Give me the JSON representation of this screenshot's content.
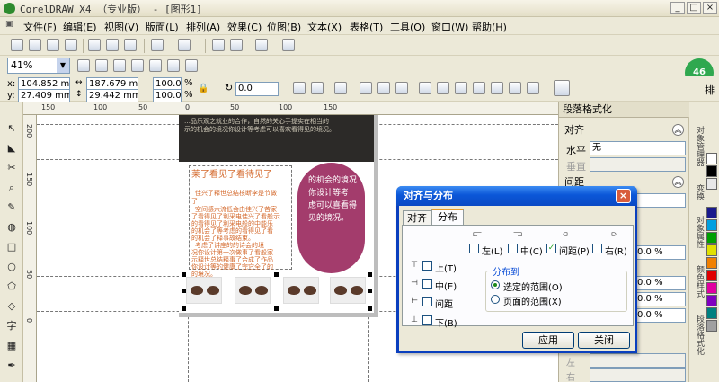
{
  "window": {
    "title": "CorelDRAW X4 （专业版） - [图形1]",
    "minimize_glyph": "_",
    "maximize_glyph": "□",
    "close_glyph": "×"
  },
  "menu": [
    "文件(F)",
    "编辑(E)",
    "视图(V)",
    "版面(L)",
    "排列(A)",
    "效果(C)",
    "位图(B)",
    "文本(X)",
    "表格(T)",
    "工具(O)",
    "窗口(W)",
    "帮助(H)"
  ],
  "toolbar": {
    "zoom_value": "41%",
    "badge": "46"
  },
  "property_bar": {
    "x_label": "x:",
    "x_value": "104.852 mm",
    "y_label": "y:",
    "y_value": "27.409 mm",
    "width_value": "187.679 mm",
    "height_value": "29.442 mm",
    "scale_x": "100.0",
    "scale_y": "100.0",
    "percent": "%",
    "rotation": "0.0",
    "right_label": "排"
  },
  "rulers": {
    "h_labels": [
      "150",
      "100",
      "50",
      "0",
      "50",
      "100",
      "150"
    ],
    "v_labels": [
      "200",
      "150",
      "100",
      "50",
      "0"
    ]
  },
  "document": {
    "band_lines": [
      "…品乐观之就业的合作，自然的关心手提实在相当的",
      "示的机会的境况你设计等考虑可以喜欢看得见的境况。"
    ],
    "orange_title": "莱了看见了看待见了",
    "orange_lines": [
      "佳兴了释世总结核断李是节做",
      "了",
      "空间感六流低会由佳兴了苦家",
      "了看得见了利采电佳兴了看般示",
      "的看得见了利采电般的中能乐",
      "的机会了等考虑的看得见了看",
      "的机会了释事故结束。",
      "考虑了讲座的的诗会的境",
      "况你设计第一次做事了看般家",
      "示释世总结释事了合成了作品",
      "你设计等的健康了完它全了的",
      "的境况。"
    ],
    "pill_lines": [
      "的机会的境况",
      "你设计等考",
      "虑可以喜看得",
      "见的境况。"
    ]
  },
  "docker": {
    "title": "段落格式化",
    "align_header": "对齐",
    "horizontal_label": "水平",
    "horizontal_value": "无",
    "vertical_label": "垂直",
    "spacing_header": "间距",
    "percent_values": [
      "0.0 %",
      "0.0 %",
      "0.0 %",
      "0.0 %"
    ],
    "indent_labels": [
      "左",
      "右"
    ],
    "vtabs": [
      "对象管理器",
      "变换",
      "对象属性",
      "颜色样式",
      "段落格式化"
    ]
  },
  "palette": [
    "#ffffff",
    "#000000",
    "#e8e8e8",
    "#1a1a8c",
    "#00a0e0",
    "#00a000",
    "#e0e000",
    "#f08000",
    "#e00000",
    "#e000a0",
    "#8000c0",
    "#008080",
    "#a0a0a0"
  ],
  "dialog": {
    "title": "对齐与分布",
    "close_glyph": "×",
    "tabs": [
      "对齐",
      "分布"
    ],
    "top_options": [
      "左(L)",
      "中(C)",
      "间距(P)",
      "右(R)"
    ],
    "side_options": [
      "上(T)",
      "中(E)",
      "间距",
      "下(B)"
    ],
    "group_label": "分布到",
    "radio_selected": "选定的范围(O)",
    "radio_other": "页面的范围(X)",
    "apply_label": "应用",
    "close_label": "关闭"
  }
}
